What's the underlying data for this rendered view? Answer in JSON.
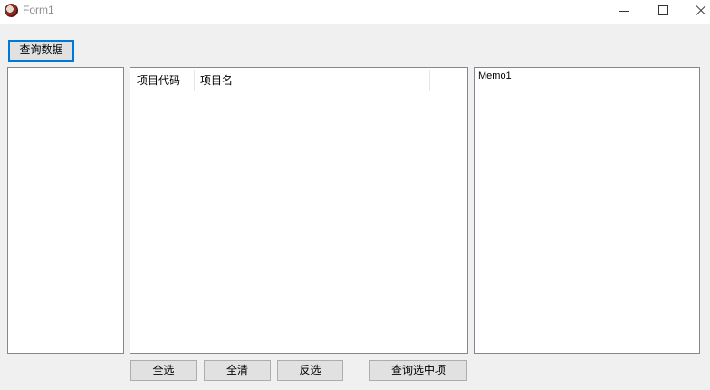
{
  "window": {
    "title": "Form1"
  },
  "toolbar": {
    "query_label": "查询数据"
  },
  "list": {
    "columns": [
      "项目代码",
      "项目名"
    ]
  },
  "memo": {
    "text": "Memo1"
  },
  "actions": {
    "select_all": "全选",
    "clear_all": "全清",
    "invert": "反选",
    "query_selected": "查询选中项"
  }
}
